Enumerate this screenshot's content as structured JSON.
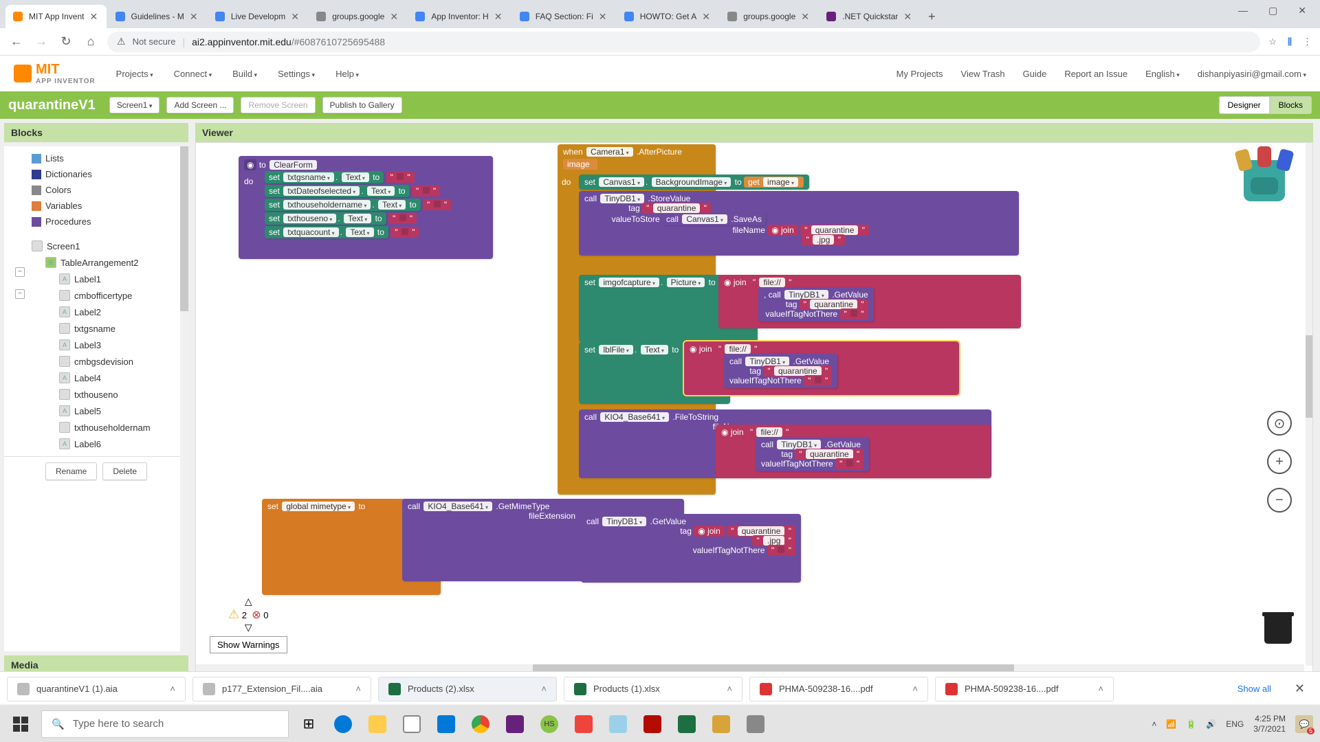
{
  "tabs": [
    {
      "label": "MIT App Invent",
      "active": true,
      "fav": "#ff8800"
    },
    {
      "label": "Guidelines - M",
      "fav": "#4285f4"
    },
    {
      "label": "Live Developm",
      "fav": "#4285f4"
    },
    {
      "label": "groups.google",
      "fav": "#888"
    },
    {
      "label": "App Inventor: H",
      "fav": "#4285f4"
    },
    {
      "label": "FAQ Section: Fi",
      "fav": "#4285f4"
    },
    {
      "label": "HOWTO: Get A",
      "fav": "#4285f4"
    },
    {
      "label": "groups.google",
      "fav": "#888"
    },
    {
      "label": ".NET Quickstar",
      "fav": "#68217a"
    }
  ],
  "address": {
    "not_secure": "Not secure",
    "host": "ai2.appinventor.mit.edu",
    "path": "/#6087610725695488"
  },
  "app_menus": [
    "Projects",
    "Connect",
    "Build",
    "Settings",
    "Help"
  ],
  "right_links": {
    "projects": "My Projects",
    "trash": "View Trash",
    "guide": "Guide",
    "report": "Report an Issue",
    "lang": "English",
    "user": "dishanpiyasiri@gmail.com"
  },
  "project": {
    "name": "quarantineV1",
    "screen": "Screen1",
    "add": "Add Screen ...",
    "remove": "Remove Screen",
    "publish": "Publish to Gallery",
    "designer": "Designer",
    "blocks": "Blocks"
  },
  "panels": {
    "blocks": "Blocks",
    "viewer": "Viewer",
    "media": "Media"
  },
  "palette": [
    {
      "label": "Lists",
      "color": "#5b9bd5"
    },
    {
      "label": "Dictionaries",
      "color": "#2e3b8f"
    },
    {
      "label": "Colors",
      "color": "#888"
    },
    {
      "label": "Variables",
      "color": "#e07c3e"
    },
    {
      "label": "Procedures",
      "color": "#6d4c9f"
    }
  ],
  "tree": {
    "screen": "Screen1",
    "table": "TableArrangement2",
    "children": [
      "Label1",
      "cmbofficertype",
      "Label2",
      "txtgsname",
      "Label3",
      "cmbgsdevision",
      "Label4",
      "txthouseno",
      "Label5",
      "txthouseholdernam",
      "Label6"
    ]
  },
  "buttons": {
    "rename": "Rename",
    "delete": "Delete",
    "show_warnings": "Show Warnings"
  },
  "blocks_content": {
    "clearform": {
      "to": "to",
      "name": "ClearForm",
      "do": "do",
      "rows": [
        {
          "set": "set",
          "comp": "txtgsname",
          "prop": "Text",
          "to": "to"
        },
        {
          "set": "set",
          "comp": "txtDateofselected",
          "prop": "Text",
          "to": "to"
        },
        {
          "set": "set",
          "comp": "txthouseholdername",
          "prop": "Text",
          "to": "to"
        },
        {
          "set": "set",
          "comp": "txthouseno",
          "prop": "Text",
          "to": "to"
        },
        {
          "set": "set",
          "comp": "txtquacount",
          "prop": "Text",
          "to": "to"
        }
      ]
    },
    "camera": {
      "when": "when",
      "comp": "Camera1",
      "evt": ".AfterPicture",
      "param": "image",
      "do": "do",
      "set_canvas": {
        "set": "set",
        "comp": "Canvas1",
        "prop": "BackgroundImage",
        "to": "to",
        "get": "get",
        "var": "image"
      },
      "tinydb_store": {
        "call": "call",
        "comp": "TinyDB1",
        "method": ".StoreValue",
        "tag_label": "tag",
        "tag": "quarantine",
        "vts": "valueToStore",
        "call2": "call",
        "comp2": "Canvas1",
        "method2": ".SaveAs",
        "filename_label": "fileName",
        "join": "join",
        "q1": "quarantine",
        "q2": ".jpg"
      },
      "set_img": {
        "set": "set",
        "comp": "imgofcapture",
        "prop": "Picture",
        "to": "to",
        "join": "join",
        "f": "file://",
        "call": "call",
        "c": "TinyDB1",
        "m": ".GetValue",
        "tag_label": "tag",
        "tag": "quarantine",
        "v": "valueIfTagNotThere"
      },
      "set_lbl": {
        "set": "set",
        "comp": "lblFile",
        "prop": "Text",
        "to": "to",
        "join": "join",
        "f": "file://",
        "call": "call",
        "c": "TinyDB1",
        "m": ".GetValue",
        "tag_label": "tag",
        "tag": "quarantine",
        "v": "valueIfTagNotThere"
      },
      "kio4": {
        "call": "call",
        "comp": "KIO4_Base641",
        "method": ".FileToString",
        "fn": "fileName",
        "join": "join",
        "f": "file://",
        "call2": "call",
        "c": "TinyDB1",
        "m": ".GetValue",
        "tag_label": "tag",
        "tag": "quarantine",
        "v": "valueIfTagNotThere"
      }
    },
    "mimetype": {
      "set": "set",
      "var": "global mimetype",
      "to": "to",
      "call": "call",
      "comp": "KIO4_Base641",
      "method": ".GetMimeType",
      "fe": "fileExtension",
      "call2": "call",
      "c": "TinyDB1",
      "m": ".GetValue",
      "tag_label": "tag",
      "join": "join",
      "q1": "quarantine",
      "q2": ".jpg",
      "v": "valueIfTagNotThere"
    }
  },
  "warn": {
    "warns": "2",
    "errs": "0"
  },
  "downloads": [
    {
      "name": "quarantineV1 (1).aia",
      "icon": "#bbb"
    },
    {
      "name": "p177_Extension_Fil....aia",
      "icon": "#bbb"
    },
    {
      "name": "Products (2).xlsx",
      "icon": "#1d6f42",
      "active": true
    },
    {
      "name": "Products (1).xlsx",
      "icon": "#1d6f42"
    },
    {
      "name": "PHMA-509238-16....pdf",
      "icon": "#d33"
    },
    {
      "name": "PHMA-509238-16....pdf",
      "icon": "#d33"
    }
  ],
  "showall": "Show all",
  "taskbar": {
    "search": "Type here to search",
    "lang": "ENG",
    "time": "4:25 PM",
    "date": "3/7/2021",
    "notif": "5"
  }
}
